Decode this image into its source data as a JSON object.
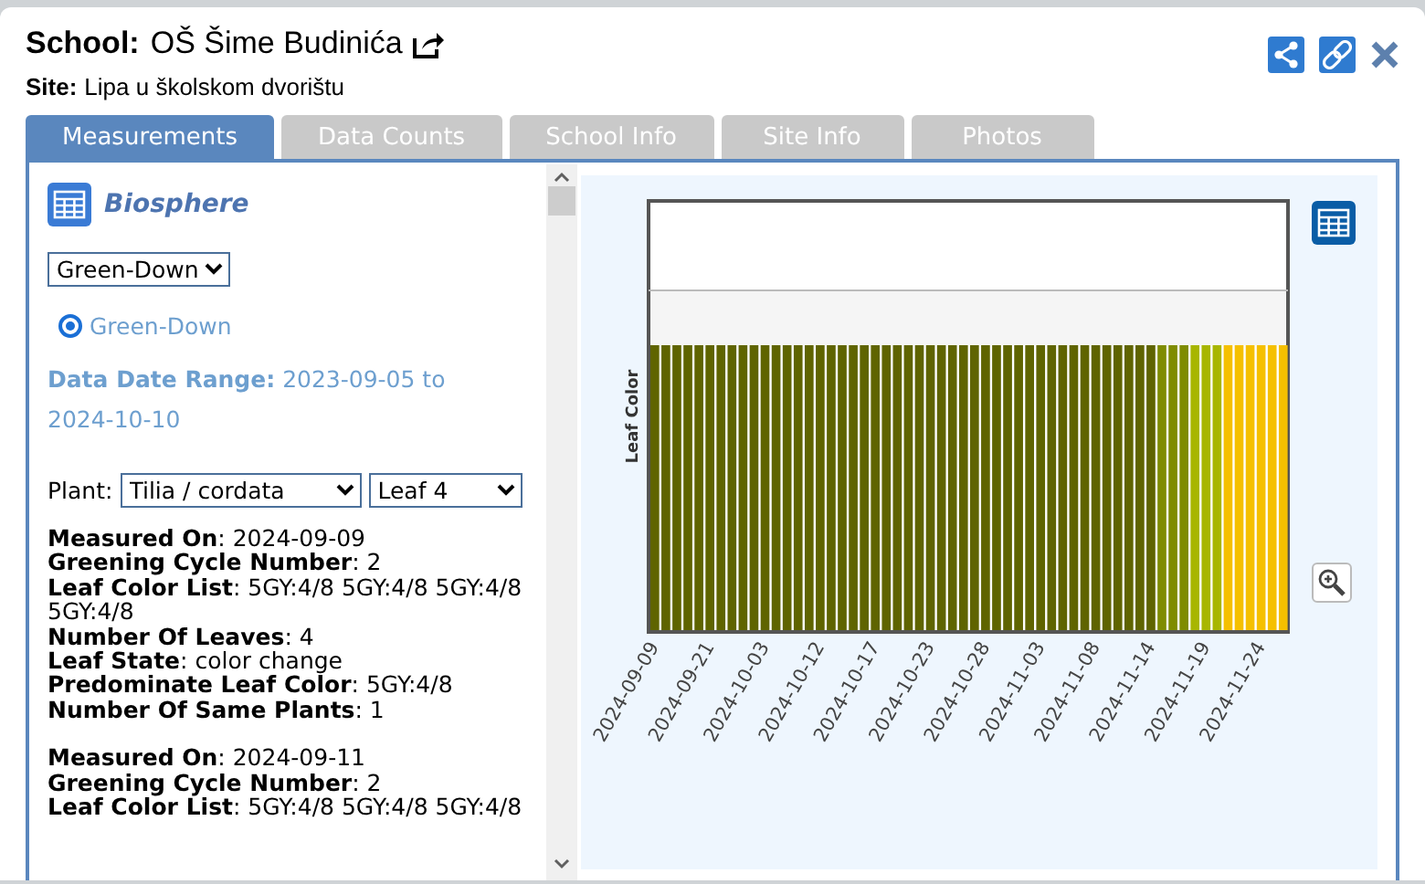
{
  "header": {
    "school_label": "School:",
    "school_name": "OŠ Šime Budinića",
    "site_label": "Site:",
    "site_name": "Lipa u školskom dvorištu"
  },
  "tabs": [
    {
      "label": "Measurements",
      "selected": true
    },
    {
      "label": "Data Counts",
      "selected": false
    },
    {
      "label": "School Info",
      "selected": false
    },
    {
      "label": "Site Info",
      "selected": false
    },
    {
      "label": "Photos",
      "selected": false
    }
  ],
  "protocol": {
    "title": "Biosphere",
    "dropdown": "Green-Down",
    "options": [
      {
        "label": "Green-Down",
        "selected": true
      }
    ],
    "range_label": "Data Date Range:",
    "range_value": "2023-09-05 to 2024-10-10"
  },
  "plant": {
    "label": "Plant:",
    "species": "Tilia / cordata",
    "leaf": "Leaf 4"
  },
  "records": [
    {
      "lines": [
        "**Measured On**: 2024-09-09",
        "**Greening Cycle Number**: 2",
        "**Leaf Color List**: 5GY:4/8 5GY:4/8 5GY:4/8 5GY:4/8",
        "**Number Of Leaves**: 4",
        "**Leaf State**: color change",
        "**Predominate Leaf Color**: 5GY:4/8",
        "**Number Of Same Plants**: 1"
      ]
    },
    {
      "lines": [
        "**Measured On**: 2024-09-11",
        "**Greening Cycle Number**: 2",
        "**Leaf Color List**: 5GY:4/8 5GY:4/8 5GY:4/8"
      ]
    }
  ],
  "chart": {
    "ylabel": "Leaf Color",
    "x_labels": [
      "2024-09-09",
      "2024-09-21",
      "2024-10-03",
      "2024-10-12",
      "2024-10-17",
      "2024-10-23",
      "2024-10-28",
      "2024-11-03",
      "2024-11-08",
      "2024-11-14",
      "2024-11-19",
      "2024-11-24"
    ],
    "bars": [
      {
        "color": "#5f6400"
      },
      {
        "color": "#5f6400"
      },
      {
        "color": "#5f6400"
      },
      {
        "color": "#5f6400"
      },
      {
        "color": "#5f6400"
      },
      {
        "color": "#5f6400"
      },
      {
        "color": "#5f6400"
      },
      {
        "color": "#5f6400"
      },
      {
        "color": "#5f6400"
      },
      {
        "color": "#5f6400"
      },
      {
        "color": "#5f6400"
      },
      {
        "color": "#5f6400"
      },
      {
        "color": "#5f6400"
      },
      {
        "color": "#5f6400"
      },
      {
        "color": "#5f6400"
      },
      {
        "color": "#5f6400"
      },
      {
        "color": "#5f6400"
      },
      {
        "color": "#5f6400"
      },
      {
        "color": "#5f6400"
      },
      {
        "color": "#5f6400"
      },
      {
        "color": "#5f6400"
      },
      {
        "color": "#5f6400"
      },
      {
        "color": "#5f6400"
      },
      {
        "color": "#5f6400"
      },
      {
        "color": "#5f6400"
      },
      {
        "color": "#5f6400"
      },
      {
        "color": "#5f6400"
      },
      {
        "color": "#5f6400"
      },
      {
        "color": "#5f6400"
      },
      {
        "color": "#5f6400"
      },
      {
        "color": "#5f6400"
      },
      {
        "color": "#5f6400"
      },
      {
        "color": "#5f6400"
      },
      {
        "color": "#5f6400"
      },
      {
        "color": "#5f6400"
      },
      {
        "color": "#5f6400"
      },
      {
        "color": "#5f6400"
      },
      {
        "color": "#5f6400"
      },
      {
        "color": "#5f6400"
      },
      {
        "color": "#5f6400"
      },
      {
        "color": "#5f6400"
      },
      {
        "color": "#5f6400"
      },
      {
        "color": "#5f6400"
      },
      {
        "color": "#5f6400"
      },
      {
        "color": "#5f6400"
      },
      {
        "color": "#5f6400"
      },
      {
        "color": "#7f8c00"
      },
      {
        "color": "#7f8c00"
      },
      {
        "color": "#7f8c00"
      },
      {
        "color": "#a8b600"
      },
      {
        "color": "#a8b600"
      },
      {
        "color": "#a8b600"
      },
      {
        "color": "#f5c000"
      },
      {
        "color": "#f5c000"
      },
      {
        "color": "#f5c000"
      },
      {
        "color": "#f5c000"
      },
      {
        "color": "#f5c000"
      },
      {
        "color": "#f5c000"
      }
    ]
  }
}
